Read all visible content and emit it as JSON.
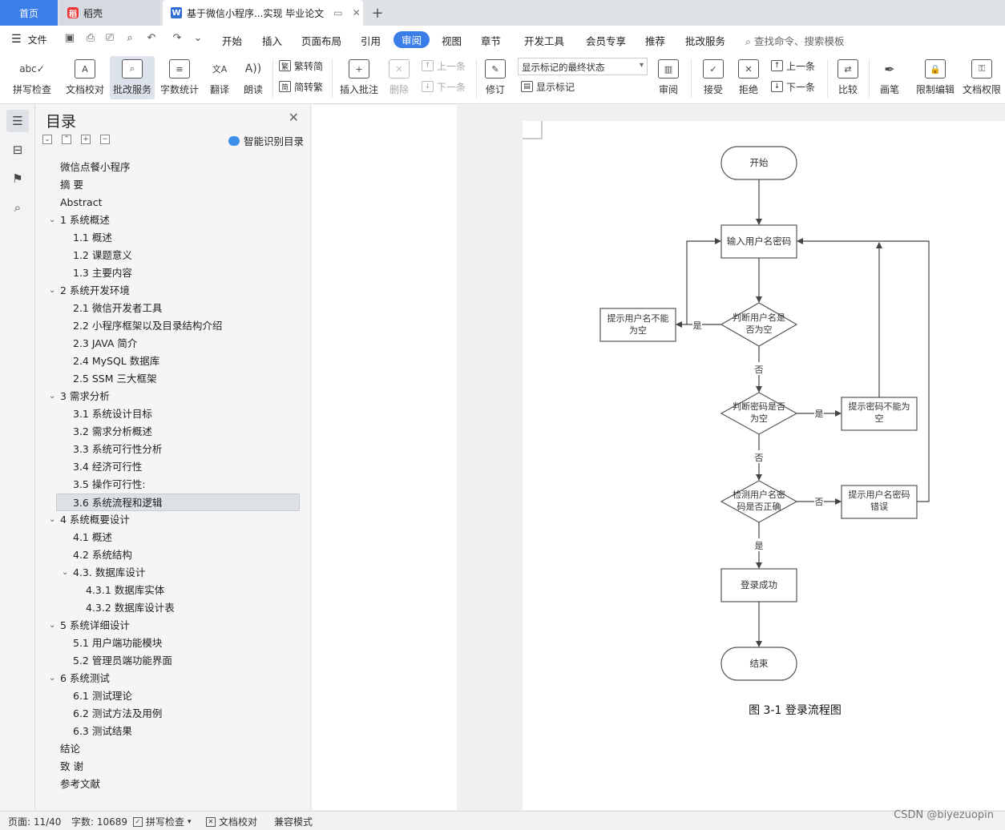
{
  "tabs": {
    "home": "首页",
    "daoke": "稻壳",
    "document": "基于微信小程序...实现 毕业论文",
    "add": "+"
  },
  "menu": {
    "file": "文件",
    "items": [
      "开始",
      "插入",
      "页面布局",
      "引用",
      "审阅",
      "视图",
      "章节",
      "开发工具",
      "会员专享",
      "推荐",
      "批改服务"
    ],
    "active": "审阅",
    "search_placeholder": "查找命令、搜索模板"
  },
  "ribbon": {
    "spellcheck": "拼写检查",
    "doc_proof": "文档校对",
    "correction": "批改服务",
    "word_count": "字数统计",
    "translate": "翻译",
    "read_aloud": "朗读",
    "trad": "繁转简",
    "simp": "简转繁",
    "insert_comment": "插入批注",
    "delete": "删除",
    "prev_disabled": "上一条",
    "next_disabled": "下一条",
    "revise": "修订",
    "markup_state": "显示标记的最终状态",
    "show_markup": "显示标记",
    "review": "审阅",
    "accept": "接受",
    "reject": "拒绝",
    "prev": "上一条",
    "next": "下一条",
    "compare": "比较",
    "pen": "画笔",
    "restrict": "限制编辑",
    "permission": "文档权限"
  },
  "toc": {
    "title": "目录",
    "smart": "智能识别目录",
    "entries": [
      {
        "text": "微信点餐小程序",
        "level": 0,
        "caret": ""
      },
      {
        "text": "摘  要",
        "level": 0,
        "caret": ""
      },
      {
        "text": "Abstract",
        "level": 0,
        "caret": ""
      },
      {
        "text": "1  系统概述",
        "level": 0,
        "caret": "v"
      },
      {
        "text": "1.1  概述",
        "level": 1,
        "caret": ""
      },
      {
        "text": "1.2 课题意义",
        "level": 1,
        "caret": ""
      },
      {
        "text": "1.3  主要内容",
        "level": 1,
        "caret": ""
      },
      {
        "text": "2  系统开发环境",
        "level": 0,
        "caret": "v"
      },
      {
        "text": "2.1 微信开发者工具",
        "level": 1,
        "caret": ""
      },
      {
        "text": "2.2 小程序框架以及目录结构介绍",
        "level": 1,
        "caret": ""
      },
      {
        "text": "2.3 JAVA 简介",
        "level": 1,
        "caret": ""
      },
      {
        "text": "2.4 MySQL 数据库",
        "level": 1,
        "caret": ""
      },
      {
        "text": "2.5 SSM 三大框架",
        "level": 1,
        "caret": ""
      },
      {
        "text": "3  需求分析",
        "level": 0,
        "caret": "v"
      },
      {
        "text": "3.1  系统设计目标",
        "level": 1,
        "caret": ""
      },
      {
        "text": "3.2 需求分析概述",
        "level": 1,
        "caret": ""
      },
      {
        "text": "3.3  系统可行性分析",
        "level": 1,
        "caret": ""
      },
      {
        "text": "3.4 经济可行性",
        "level": 1,
        "caret": ""
      },
      {
        "text": "3.5 操作可行性:",
        "level": 1,
        "caret": ""
      },
      {
        "text": "3.6 系统流程和逻辑",
        "level": 1,
        "caret": "",
        "selected": true
      },
      {
        "text": "4 系统概要设计",
        "level": 0,
        "caret": "v"
      },
      {
        "text": "4.1  概述",
        "level": 1,
        "caret": ""
      },
      {
        "text": "4.2  系统结构",
        "level": 1,
        "caret": ""
      },
      {
        "text": "4.3.  数据库设计",
        "level": 1,
        "caret": "v"
      },
      {
        "text": "4.3.1  数据库实体",
        "level": 2,
        "caret": ""
      },
      {
        "text": "4.3.2  数据库设计表",
        "level": 2,
        "caret": ""
      },
      {
        "text": "5 系统详细设计",
        "level": 0,
        "caret": "v"
      },
      {
        "text": "5.1 用户端功能模块",
        "level": 1,
        "caret": ""
      },
      {
        "text": "5.2 管理员端功能界面",
        "level": 1,
        "caret": ""
      },
      {
        "text": "6  系统测试",
        "level": 0,
        "caret": "v"
      },
      {
        "text": "6.1  测试理论",
        "level": 1,
        "caret": ""
      },
      {
        "text": "6.2  测试方法及用例",
        "level": 1,
        "caret": ""
      },
      {
        "text": "6.3 测试结果",
        "level": 1,
        "caret": ""
      },
      {
        "text": "结论",
        "level": 0,
        "caret": ""
      },
      {
        "text": "致    谢",
        "level": 0,
        "caret": ""
      },
      {
        "text": "参考文献",
        "level": 0,
        "caret": ""
      }
    ]
  },
  "flowchart": {
    "start": "开始",
    "input": "输入用户名密码",
    "check_user_1": "判断用户名是",
    "check_user_2": "否为空",
    "warn_user_1": "提示用户名不能",
    "warn_user_2": "为空",
    "check_pwd_1": "判断密码是否",
    "check_pwd_2": "为空",
    "warn_pwd_1": "提示密码不能为",
    "warn_pwd_2": "空",
    "verify_1": "检测用户名密",
    "verify_2": "码是否正确",
    "warn_wrong_1": "提示用户名密码",
    "warn_wrong_2": "错误",
    "success": "登录成功",
    "end": "结束",
    "yes": "是",
    "no": "否",
    "caption": "图 3-1 登录流程图"
  },
  "status": {
    "page": "页面: 11/40",
    "words": "字数: 10689",
    "spell": "拼写检查",
    "proof": "文档校对",
    "compat": "兼容模式"
  },
  "watermark": "CSDN @biyezuopin"
}
